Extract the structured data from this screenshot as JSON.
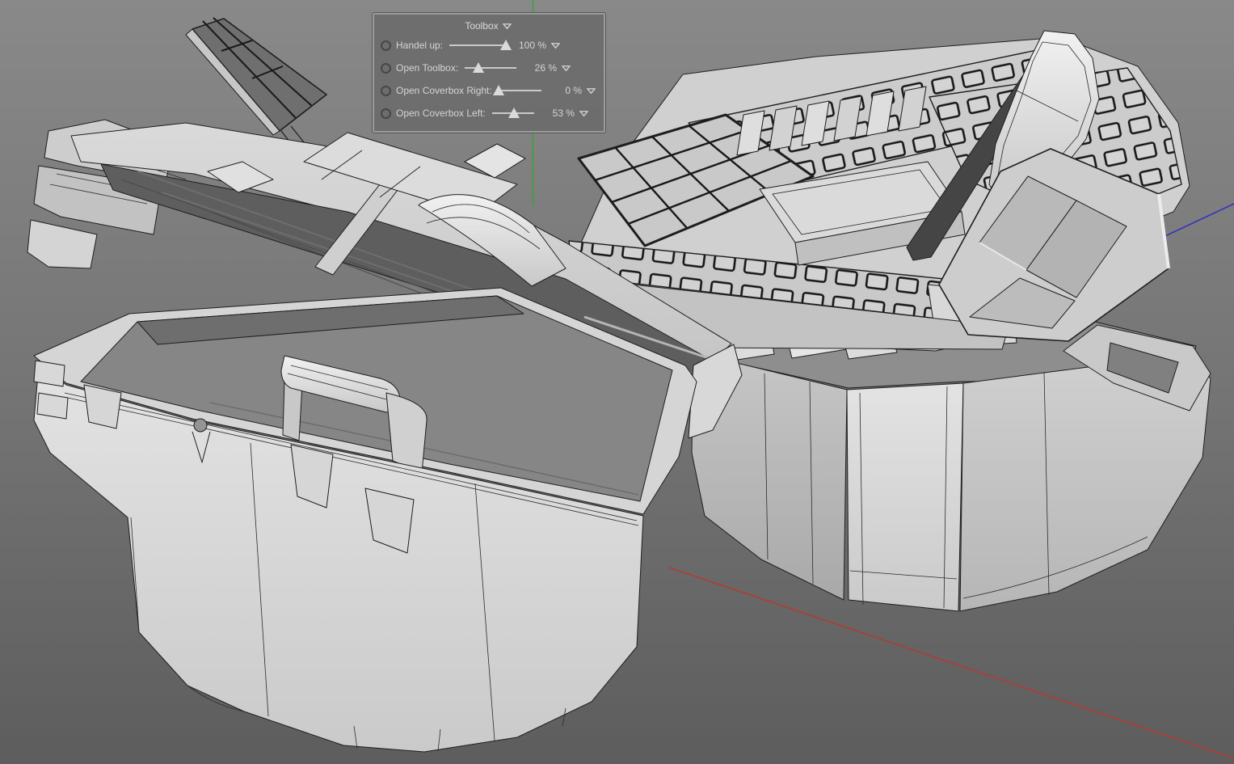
{
  "viewport": {
    "background_top": "#898989",
    "background_middle": "#757575",
    "background_bottom": "#5d5d5d",
    "axes": {
      "x_color": "#b23b33",
      "y_color": "#3f9e3f",
      "z_color": "#3434b8"
    },
    "models": [
      "open-toolbox-wireframe",
      "closed-toolbox-with-open-trays-wireframe"
    ],
    "wireframe_color": "#1e1e1e"
  },
  "hud": {
    "title": "Toolbox",
    "sliders": [
      {
        "label": "Handel up:",
        "value": 100,
        "display": "100 %"
      },
      {
        "label": "Open Toolbox:",
        "value": 26,
        "display": "26 %"
      },
      {
        "label": "Open Coverbox Right:",
        "value": 0,
        "display": "0 %"
      },
      {
        "label": "Open Coverbox Left:",
        "value": 53,
        "display": "53 %"
      }
    ]
  }
}
